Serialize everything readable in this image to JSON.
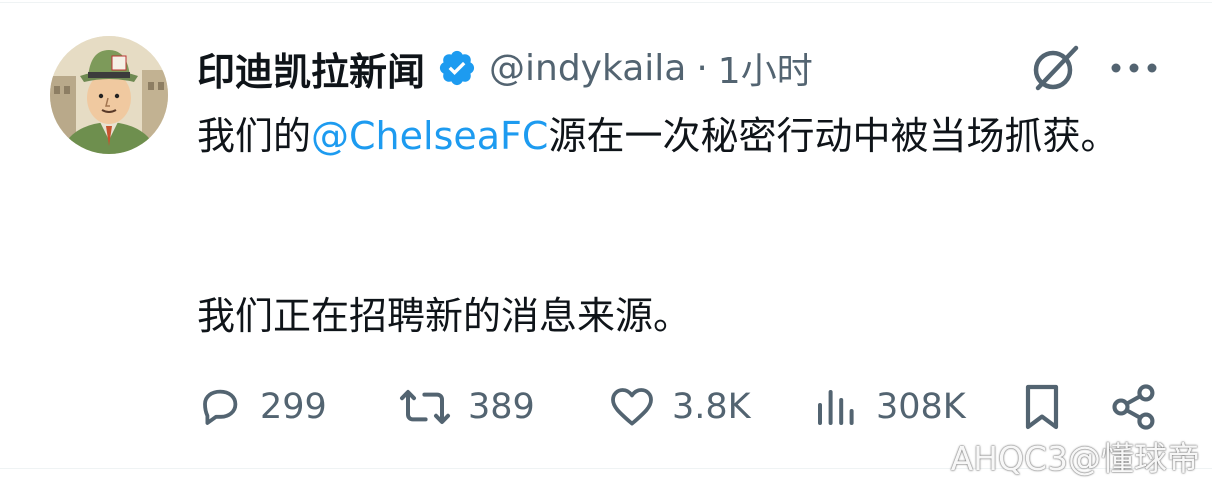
{
  "tweet": {
    "display_name": "印迪凯拉新闻",
    "handle": "@indykaila",
    "separator": "·",
    "time": "1小时",
    "body": {
      "line1_prefix": "我们的",
      "mention": "@ChelseaFC",
      "line1_suffix": "源在一次秘密行动中被当场抓获。",
      "line2": "我们正在招聘新的消息来源。"
    },
    "stats": {
      "replies": "299",
      "retweets": "389",
      "likes": "3.8K",
      "views": "308K"
    }
  },
  "watermark": "AHQC3@懂球帝",
  "colors": {
    "text": "#0f1419",
    "secondary": "#536471",
    "accent": "#1d9bf0"
  },
  "icons": [
    "verified-badge-icon",
    "grok-icon",
    "more-icon",
    "reply-icon",
    "retweet-icon",
    "like-icon",
    "views-icon",
    "bookmark-icon",
    "share-icon"
  ]
}
